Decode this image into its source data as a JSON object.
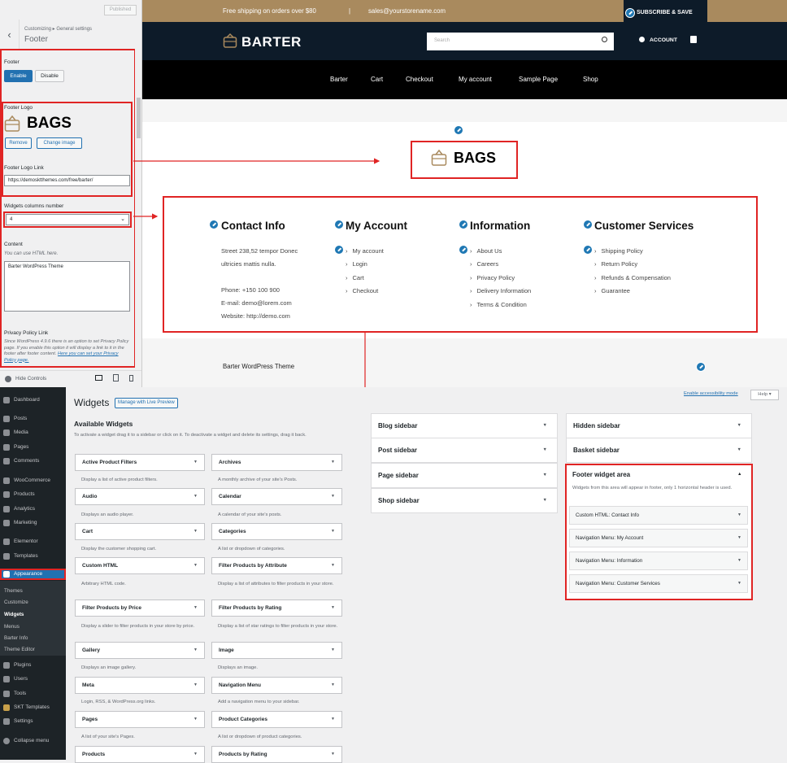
{
  "customizer": {
    "publish_label": "Published",
    "breadcrumb": "Customizing ▸ General settings",
    "section_title": "Footer",
    "footer_label": "Footer",
    "enable_label": "Enable",
    "disable_label": "Disable",
    "footer_logo_label": "Footer Logo",
    "logo_text": "BAGS",
    "remove_label": "Remove",
    "change_image_label": "Change image",
    "footer_logo_link_label": "Footer Logo Link",
    "footer_logo_link_value": "https://demosktthemes.com/free/barter/",
    "widgets_columns_label": "Widgets columns number",
    "widgets_columns_value": "4",
    "content_label": "Content",
    "content_hint": "You can use HTML here.",
    "content_value": "Barter WordPress Theme",
    "privacy_label": "Privacy Policy Link",
    "privacy_text": "Since WordPress 4.9.6 there is an option to set Privacy Policy page. If you enable this option it will display a link to it in the footer after footer content.",
    "privacy_link": "Here you can set your Privacy Policy page.",
    "hide_controls": "Hide Controls"
  },
  "store": {
    "topbar_shipping": "Free shipping on orders over $80",
    "topbar_sep": "|",
    "topbar_email": "sales@yourstorename.com",
    "subscribe": "SUBSCRIBE & SAVE",
    "brand": "BARTER",
    "search_placeholder": "Search",
    "account": "ACCOUNT",
    "nav": [
      "Barter",
      "Cart",
      "Checkout",
      "My account",
      "Sample Page",
      "Shop"
    ],
    "footer_logo_text": "BAGS",
    "columns": [
      {
        "title": "Contact Info",
        "lines": [
          "Street 238,52 tempor Donec",
          "ultricies mattis nulla.",
          "",
          "Phone: +150 100 900",
          "E-mail: demo@lorem.com",
          "Website: http://demo.com"
        ]
      },
      {
        "title": "My Account",
        "items": [
          "My account",
          "Login",
          "Cart",
          "Checkout"
        ]
      },
      {
        "title": "Information",
        "items": [
          "About Us",
          "Careers",
          "Privacy Policy",
          "Delivery Information",
          "Terms & Condition"
        ]
      },
      {
        "title": "Customer Services",
        "items": [
          "Shipping Policy",
          "Return Policy",
          "Refunds & Compensation",
          "Guarantee"
        ]
      }
    ],
    "copyright": "Barter WordPress Theme"
  },
  "admin_menu": {
    "items": [
      "Dashboard",
      "Posts",
      "Media",
      "Pages",
      "Comments",
      "WooCommerce",
      "Products",
      "Analytics",
      "Marketing",
      "Elementor",
      "Templates",
      "Appearance"
    ],
    "appearance_sub": [
      "Themes",
      "Customize",
      "Widgets",
      "Menus",
      "Barter Info",
      "Theme Editor"
    ],
    "bottom": [
      "Plugins",
      "Users",
      "Tools",
      "SKT Templates",
      "Settings",
      "Collapse menu"
    ]
  },
  "widgets": {
    "page_title": "Widgets",
    "live_preview": "Manage with Live Preview",
    "accessibility": "Enable accessibility mode",
    "help": "Help ▾",
    "available_title": "Available Widgets",
    "available_desc": "To activate a widget drag it to a sidebar or click on it. To deactivate a widget and delete its settings, drag it back.",
    "list": [
      {
        "name": "Active Product Filters",
        "desc": "Display a list of active product filters."
      },
      {
        "name": "Archives",
        "desc": "A monthly archive of your site's Posts."
      },
      {
        "name": "Audio",
        "desc": "Displays an audio player."
      },
      {
        "name": "Calendar",
        "desc": "A calendar of your site's posts."
      },
      {
        "name": "Cart",
        "desc": "Display the customer shopping cart."
      },
      {
        "name": "Categories",
        "desc": "A list or dropdown of categories."
      },
      {
        "name": "Custom HTML",
        "desc": "Arbitrary HTML code."
      },
      {
        "name": "Filter Products by Attribute",
        "desc": "Display a list of attributes to filter products in your store."
      },
      {
        "name": "Filter Products by Price",
        "desc": "Display a slider to filter products in your store by price."
      },
      {
        "name": "Filter Products by Rating",
        "desc": "Display a list of star ratings to filter products in your store."
      },
      {
        "name": "Gallery",
        "desc": "Displays an image gallery."
      },
      {
        "name": "Image",
        "desc": "Displays an image."
      },
      {
        "name": "Meta",
        "desc": "Login, RSS, & WordPress.org links."
      },
      {
        "name": "Navigation Menu",
        "desc": "Add a navigation menu to your sidebar."
      },
      {
        "name": "Pages",
        "desc": "A list of your site's Pages."
      },
      {
        "name": "Product Categories",
        "desc": "A list or dropdown of product categories."
      },
      {
        "name": "Products",
        "desc": ""
      },
      {
        "name": "Products by Rating",
        "desc": ""
      }
    ],
    "sidebars_left": [
      "Blog sidebar",
      "Post sidebar",
      "Page sidebar",
      "Shop sidebar"
    ],
    "sidebars_right": [
      "Hidden sidebar",
      "Basket sidebar"
    ],
    "footer_area_title": "Footer widget area",
    "footer_area_desc": "Widgets from this area will appear in footer, only 1 horizontal header is used.",
    "footer_widgets": [
      "Custom HTML: Contact Info",
      "Navigation Menu: My Account",
      "Navigation Menu: Information",
      "Navigation Menu: Customer Services"
    ]
  },
  "colors": {
    "accent": "#a98a5e",
    "header": "#0d1b29",
    "wp_blue": "#2271b1",
    "highlight": "#e02424"
  }
}
